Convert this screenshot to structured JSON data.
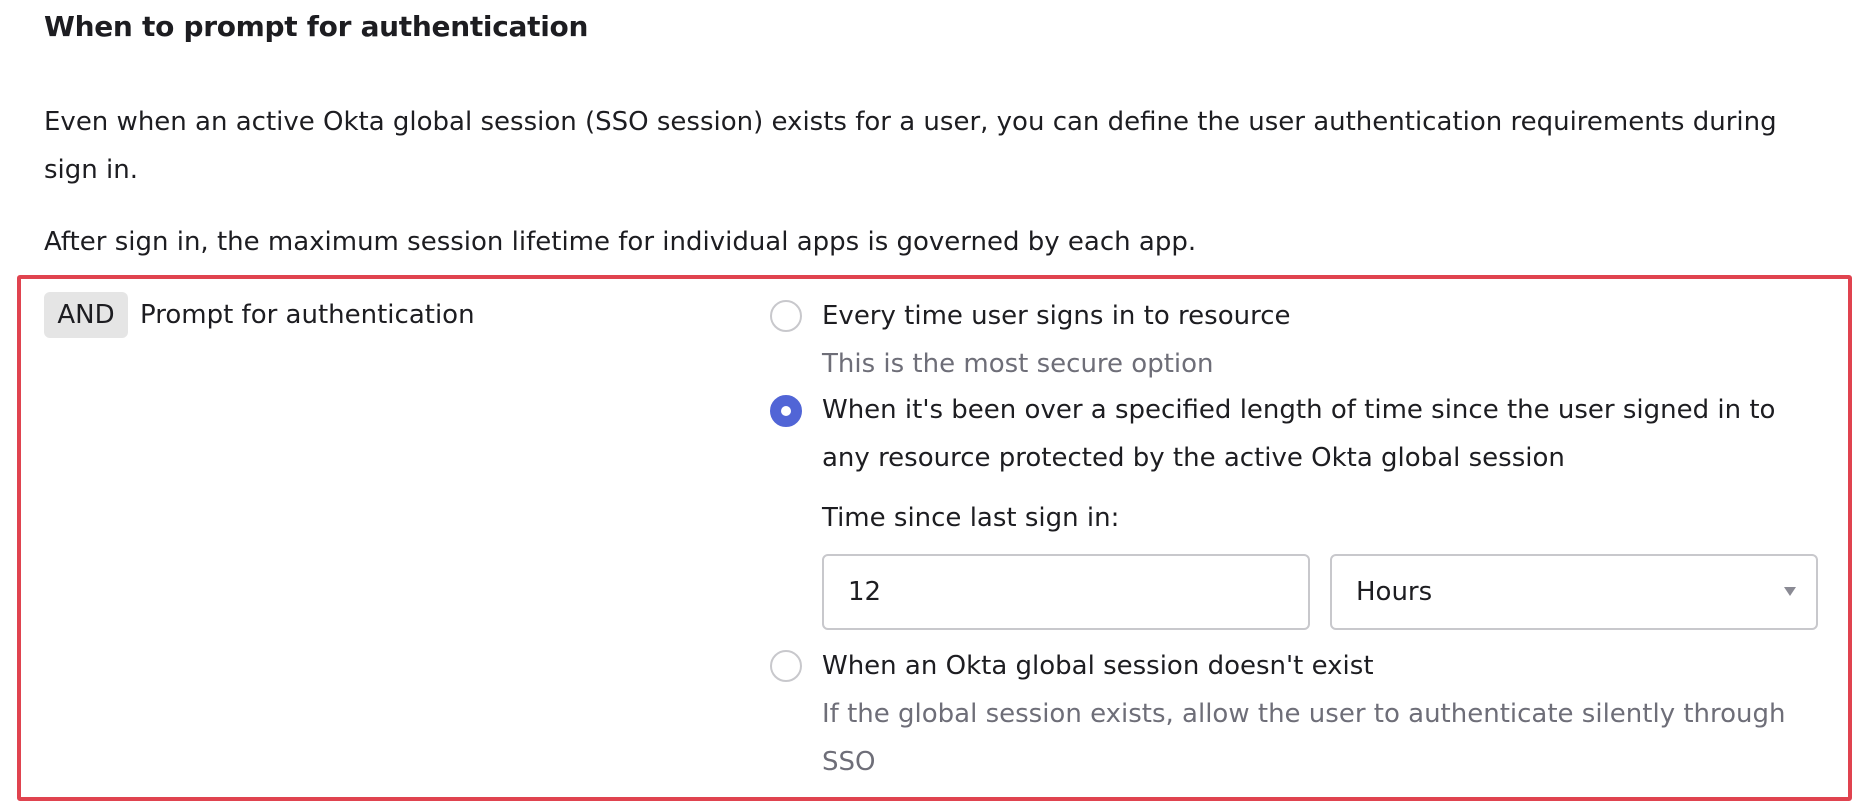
{
  "section": {
    "title": "When to prompt for authentication",
    "description_1": "Even when an active Okta global session (SSO session) exists for a user, you can define the user authentication requirements during sign in.",
    "description_2": "After sign in, the maximum session lifetime for individual apps is governed by each app."
  },
  "rule": {
    "badge": "AND",
    "label": "Prompt for authentication",
    "options": [
      {
        "label": "Every time user signs in to resource",
        "hint": "This is the most secure option",
        "selected": false
      },
      {
        "label": "When it's been over a specified length of time since the user signed in to any resource protected by the active Okta global session",
        "selected": true
      },
      {
        "label": "When an Okta global session doesn't exist",
        "hint": "If the global session exists, allow the user to authenticate silently through SSO",
        "selected": false
      }
    ],
    "time_since": {
      "label": "Time since last sign in:",
      "value": "12",
      "unit": "Hours"
    }
  },
  "colors": {
    "accent": "#5165d6",
    "highlight_border": "#e0434f"
  }
}
